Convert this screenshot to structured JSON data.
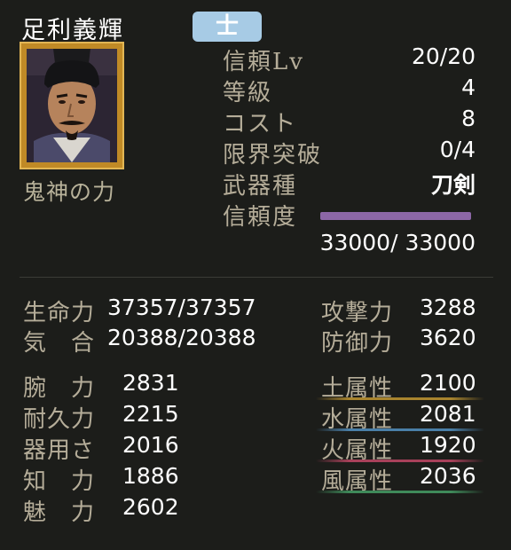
{
  "character": {
    "name": "足利義輝",
    "rank": "士",
    "skill": "鬼神の力"
  },
  "info": [
    {
      "label": "信頼Lv",
      "value": "20/20"
    },
    {
      "label": "等級",
      "value": "4"
    },
    {
      "label": "コスト",
      "value": "8"
    },
    {
      "label": "限界突破",
      "value": "0/4"
    },
    {
      "label": "武器種",
      "value": "刀剣"
    },
    {
      "label": "信頼度",
      "value": ""
    }
  ],
  "trust": {
    "current": 33000,
    "max": 33000,
    "display": "33000/ 33000",
    "fill_fraction": 1.0,
    "color": "#8c67a6"
  },
  "stats_main": [
    {
      "label": "生命力",
      "value": "37357/37357"
    },
    {
      "label": "気　合",
      "value": "20388/20388"
    }
  ],
  "stats_combat": [
    {
      "label": "攻撃力",
      "value": "3288"
    },
    {
      "label": "防御力",
      "value": "3620"
    }
  ],
  "stats_base": [
    {
      "label": "腕　力",
      "value": "2831"
    },
    {
      "label": "耐久力",
      "value": "2215"
    },
    {
      "label": "器用さ",
      "value": "2016"
    },
    {
      "label": "知　力",
      "value": "1886"
    },
    {
      "label": "魅　力",
      "value": "2602"
    }
  ],
  "stats_elements": [
    {
      "label": "土属性",
      "value": "2100",
      "color": "#a9852e"
    },
    {
      "label": "水属性",
      "value": "2081",
      "color": "#4a7fa8"
    },
    {
      "label": "火属性",
      "value": "1920",
      "color": "#a8415a"
    },
    {
      "label": "風属性",
      "value": "2036",
      "color": "#3f8a5a"
    }
  ]
}
